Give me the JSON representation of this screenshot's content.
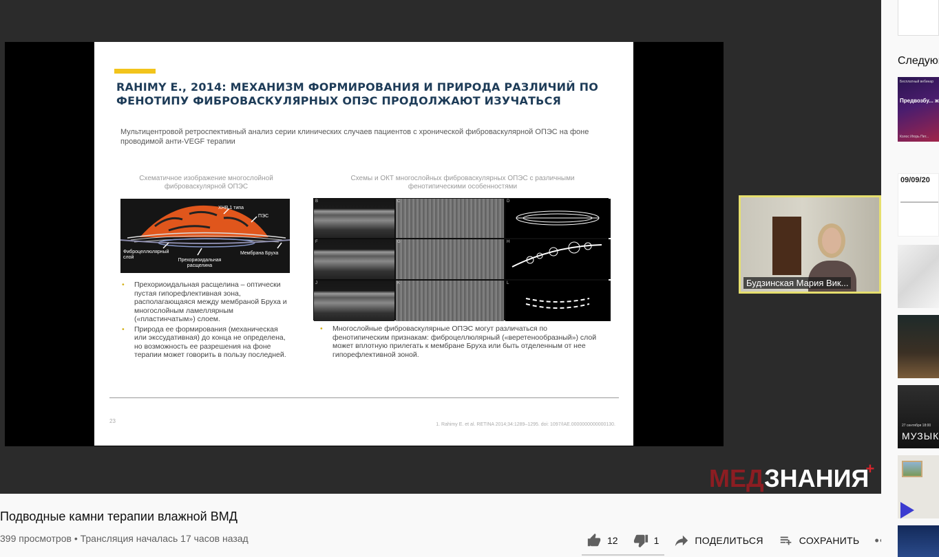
{
  "slide": {
    "title": "RAHIMY E., 2014: МЕХАНИЗМ ФОРМИРОВАНИЯ И ПРИРОДА РАЗЛИЧИЙ ПО ФЕНОТИПУ ФИБРОВАСКУЛЯРНЫХ ОПЭС ПРОДОЛЖАЮТ ИЗУЧАТЬСЯ",
    "subtitle": "Мультицентровой ретроспективный анализ серии клинических случаев пациентов с хронической фиброваскулярной ОПЭС на фоне проводимой анти-VEGF терапии",
    "left_caption": "Схематичное изображение многослойной фиброваскулярной ОПЭС",
    "right_caption": "Схемы и ОКТ многослойных фиброваскулярных ОПЭС с различными фенотипическими особенностями",
    "scheme_labels": {
      "hnv": "ХНВ 1 типа",
      "pes": "ПЭС",
      "fibro": "Фиброцеллюлярный слой",
      "prechor": "Прехориоидальная расщелина",
      "bruch": "Мембрана Бруха"
    },
    "oct_tags": [
      "B",
      "C",
      "D",
      "F",
      "G",
      "H",
      "J",
      "K",
      "L"
    ],
    "left_bullets": [
      "Прехориоидальная расщелина – оптически пустая гипорефлективная зона, располагающаяся между мембраной Бруха и многослойным ламеллярным («пластинчатым») слоем.",
      "Природа ее формирования (механическая или экссудативная) до конца не определена, но возможность ее разрешения на фоне терапии может говорить в пользу последней."
    ],
    "right_bullets": [
      "Многослойные фиброваскулярные ОПЭС могут различаться по фенотипическим признакам: фиброцеллюлярный («веретенообразный») слой может вплотную прилегать к мембране Бруха или быть отделенным от нее гипорефлективной зоной."
    ],
    "page_number": "23",
    "reference": "1. Rahimy E. et al. RETINA 2014;34:1289–1295. doi: 1097/IAE.0000000000000130."
  },
  "webcam": {
    "name": "Будзинская Мария Вик..."
  },
  "logo": {
    "part1": "МЕД",
    "part2": "ЗНАНИЯ",
    "plus": "+"
  },
  "video": {
    "title": "Подводные камни терапии влажной ВМД",
    "meta": "399 просмотров • Трансляция началась 17 часов назад"
  },
  "actions": {
    "likes": "12",
    "dislikes": "1",
    "share": "ПОДЕЛИТЬСЯ",
    "save": "СОХРАНИТЬ",
    "more": "•••"
  },
  "sidebar": {
    "up_next": "Следующее",
    "thumb1_top": "Бесплатный вебинар",
    "thumb1_title": "Предвозбу... желудочко...",
    "thumb1_author": "Колос Игорь Пет...",
    "thumb2_date": "09/09/20",
    "thumb5_text": "МУЗЫК",
    "thumb5_sub": "27 сентября 18:00"
  },
  "colors": {
    "accent_yellow": "#f2c41c",
    "title_navy": "#1e3c58",
    "logo_red": "#8c1d22",
    "cam_border": "#e6df6e"
  }
}
